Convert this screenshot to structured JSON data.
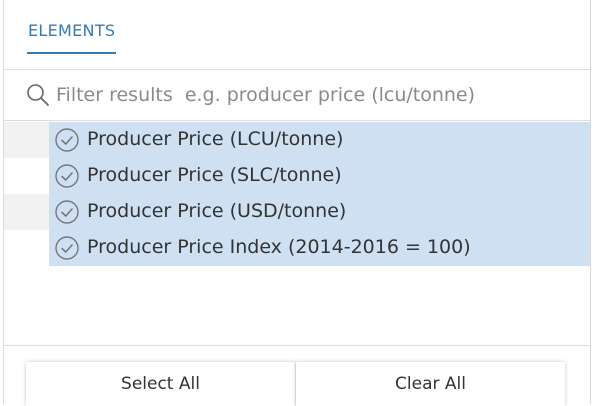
{
  "tab": {
    "label": "ELEMENTS"
  },
  "filter": {
    "icon": "search-icon",
    "value": "",
    "placeholder": "Filter results  e.g. producer price (lcu/tonne)"
  },
  "items": [
    {
      "label": "Producer Price (LCU/tonne)",
      "selected": true,
      "icon": "check-circle-icon"
    },
    {
      "label": "Producer Price (SLC/tonne)",
      "selected": true,
      "icon": "check-circle-icon"
    },
    {
      "label": "Producer Price (USD/tonne)",
      "selected": true,
      "icon": "check-circle-icon"
    },
    {
      "label": "Producer Price Index (2014-2016 = 100)",
      "selected": true,
      "icon": "check-circle-icon"
    }
  ],
  "buttons": {
    "select_all": "Select All",
    "clear_all": "Clear All"
  },
  "colors": {
    "accent": "#337ab7",
    "selected_row": "#cfe0f3"
  }
}
